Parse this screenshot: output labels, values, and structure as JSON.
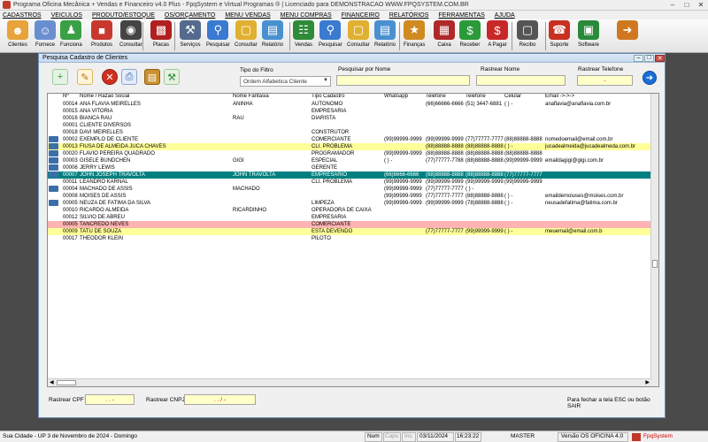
{
  "app": {
    "title": "Programa Oficina Mecânica + Vendas e Financeiro v4.0 Plus - FpqSystem e Virtual Programas ® | Licenciado para  DEMONSTRACAO WWW.FPQSYSTEM.COM.BR",
    "accent_color": "#008080"
  },
  "menu": [
    "CADASTROS",
    "VEICULOS",
    "PRODUTO/ESTOQUE",
    "OS/ORÇAMENTO",
    "MENU VENDAS",
    "MENU COMPRAS",
    "FINANCEIRO",
    "RELATÓRIOS",
    "FERRAMENTAS",
    "AJUDA"
  ],
  "toolbar": [
    {
      "label": "Clientes",
      "icon": "people-icon",
      "color": "#e8a33a"
    },
    {
      "label": "Fornece",
      "icon": "supplier-icon",
      "color": "#6a8fd0"
    },
    {
      "label": "Funciona",
      "icon": "employee-icon",
      "color": "#3aa045"
    },
    {
      "label": "Produtos",
      "icon": "products-icon",
      "color": "#c8382e"
    },
    {
      "label": "Consultar",
      "icon": "tire-icon",
      "color": "#444444"
    },
    {
      "label": "Placas",
      "icon": "car-icon",
      "color": "#b02020"
    },
    {
      "label": "Serviços",
      "icon": "tools-icon",
      "color": "#556b8d"
    },
    {
      "label": "Pesquisar",
      "icon": "search-doc-icon",
      "color": "#3a7ad0"
    },
    {
      "label": "Consultar",
      "icon": "folder-icon",
      "color": "#e0b030"
    },
    {
      "label": "Relatório",
      "icon": "report-icon",
      "color": "#4a90d0"
    },
    {
      "label": "Vendas",
      "icon": "cart-icon",
      "color": "#2e8b3a"
    },
    {
      "label": "Pesquisar",
      "icon": "search-doc-icon",
      "color": "#3a7ad0"
    },
    {
      "label": "Consultar",
      "icon": "folder-icon",
      "color": "#e0b030"
    },
    {
      "label": "Relatório",
      "icon": "report-icon",
      "color": "#4a90d0"
    },
    {
      "label": "Finanças",
      "icon": "finance-icon",
      "color": "#d08a20"
    },
    {
      "label": "Caixa",
      "icon": "cash-register-icon",
      "color": "#b02828"
    },
    {
      "label": "Receber",
      "icon": "money-receive-icon",
      "color": "#2a9a3a"
    },
    {
      "label": "A Pagar",
      "icon": "money-pay-icon",
      "color": "#c82828"
    },
    {
      "label": "Recibo",
      "icon": "receipt-icon",
      "color": "#555555"
    },
    {
      "label": "Suporte",
      "icon": "support-icon",
      "color": "#c83020"
    },
    {
      "label": "Software",
      "icon": "software-icon",
      "color": "#2a8a3a"
    },
    {
      "label": "",
      "icon": "exit-icon",
      "color": "#d07820"
    }
  ],
  "dialog": {
    "title": "Pesquisa Cadastro de Clientes",
    "filter_label": "Tipo do Filtro",
    "filter_value": "Ordem Alfabetica Cliente",
    "search_name_label": "Pesquisar por Nome",
    "search_name_value": "",
    "track_name_label": "Rastrear Nome",
    "track_name_value": "",
    "track_phone_label": "Rastrear Telefone",
    "track_phone_value": "-",
    "track_cpf_label": "Rastrear CPF",
    "track_cpf_value": ". . -",
    "track_cnpj_label": "Rastrear CNPJ",
    "track_cnpj_value": ". . / -",
    "hint": "Para fechar a tela ESC ou botão SAIR"
  },
  "grid": {
    "columns": [
      "Nº",
      "Nome / Razão Social",
      "Nome Fantasia",
      "Tipo Cadastro",
      "Whatsapp",
      "Telefone",
      "Telefone",
      "Celular",
      "Email ->->->"
    ],
    "rows": [
      {
        "mark": false,
        "style": "",
        "cells": [
          "00014",
          "ANA FLAVIA MEIRELLES",
          "ANINHA",
          "AUTONOMO",
          "",
          "(66)66666-6666",
          "(51) 3447-6881",
          "(  )    -",
          "anaflavia@anaflavia.com.br"
        ]
      },
      {
        "mark": false,
        "style": "",
        "cells": [
          "00015",
          "ANA VITORIA",
          "",
          "EMPRESARIA",
          "",
          "",
          "",
          "",
          ""
        ]
      },
      {
        "mark": false,
        "style": "",
        "cells": [
          "00016",
          "BIANCA RAU",
          "RAU",
          "DIARISTA",
          "",
          "",
          "",
          "",
          ""
        ]
      },
      {
        "mark": false,
        "style": "",
        "cells": [
          "00001",
          "CLIENTE DIVERSOS",
          "",
          "",
          "",
          "",
          "",
          "",
          ""
        ]
      },
      {
        "mark": false,
        "style": "",
        "cells": [
          "00018",
          "DAVI MEIRELLES",
          "",
          "CONSTRUTOR",
          "",
          "",
          "",
          "",
          ""
        ]
      },
      {
        "mark": true,
        "style": "",
        "cells": [
          "00002",
          "EXEMPLO DE CLIENTE",
          "",
          "COMERCIANTE",
          "(99)99999-9999",
          "(99)99999-9999",
          "(77)77777-7777",
          "(88)88888-8888",
          "nomedoemail@email.com.br"
        ]
      },
      {
        "mark": true,
        "style": "yellow",
        "cells": [
          "00013",
          "FIUSA DE ALMEIDA JUCA CHAVES",
          "",
          "CLI. PROBLEMA",
          "",
          "(88)88888-8888",
          "(88)88888-8888",
          "(  )    -",
          "jucadealmeida@jucadealmeda.com.br"
        ]
      },
      {
        "mark": true,
        "style": "",
        "cells": [
          "00020",
          "FLAVIO PEREIRA QUADRADO",
          "",
          "PROGRAMADOR",
          "(99)99999-9999",
          "(88)88888-8888",
          "(88)88888-8888",
          "(88)88888-8888",
          ""
        ]
      },
      {
        "mark": true,
        "style": "",
        "cells": [
          "00003",
          "GISELE BUNDCHEN",
          "GIGI",
          "ESPECIAL",
          "(  )    -",
          "(77)77777-7788",
          "(88)88888-8888",
          "(99)99999-9999",
          "emaildagigi@gigi.com.br"
        ]
      },
      {
        "mark": true,
        "style": "",
        "cells": [
          "00006",
          "JERRY LEWIS",
          "",
          "GERENTE",
          "",
          "",
          "",
          "",
          ""
        ]
      },
      {
        "mark": true,
        "style": "selected",
        "cells": [
          "00007",
          "JOHN JOSEPH TRAVOLTA",
          "JOHN TRAVOLTA",
          "EMPRESARIO",
          "(66)6666-6666",
          "(88)88888-8888",
          "(88)88888-8888",
          "(77)77777-7777",
          ""
        ]
      },
      {
        "mark": false,
        "style": "",
        "cells": [
          "00011",
          "LEANDRO KARNAL",
          "",
          "CLI. PROBLEMA",
          "(99)99999-9999",
          "(99)99999-9999",
          "(99)99999-9999",
          "(99)99999-9999",
          ""
        ]
      },
      {
        "mark": true,
        "style": "",
        "cells": [
          "00004",
          "MACHADO DE ASSIS",
          "MACHADO",
          "",
          "(99)99999-9999",
          "(77)77777-7777",
          "(  )    -",
          "",
          ""
        ]
      },
      {
        "mark": false,
        "style": "",
        "cells": [
          "00008",
          "MOISES DE ASSIS",
          "",
          "",
          "(99)99999-9999",
          "(77)77777-7777",
          "(88)88888-8888",
          "(  )    -",
          "emaildemoiuses@moises.com.br"
        ]
      },
      {
        "mark": true,
        "style": "",
        "cells": [
          "00005",
          "NEUZA DE FATIMA DA SILVA",
          "",
          "LIMPEZA",
          "(99)99999-9999",
          "(99)99999-9999",
          "(78)88888-8888",
          "(  )    -",
          "neusadefatima@fatima.com.br"
        ]
      },
      {
        "mark": false,
        "style": "",
        "cells": [
          "00010",
          "RICARDO ALMEIDA",
          "RICARDINHO",
          "OPERADORA DE CAIXA",
          "",
          "",
          "",
          "",
          ""
        ]
      },
      {
        "mark": false,
        "style": "",
        "cells": [
          "00012",
          "SILVIO DE ABREU",
          "",
          "EMPRESARIA",
          "",
          "",
          "",
          "",
          ""
        ]
      },
      {
        "mark": false,
        "style": "pink",
        "cells": [
          "00005",
          "TANCREDO NEVES",
          "",
          "COMERCIANTE",
          "",
          "",
          "",
          "",
          ""
        ]
      },
      {
        "mark": false,
        "style": "yellow",
        "cells": [
          "00009",
          "TATU DE SOUZA",
          "",
          "ESTA DEVENDO",
          "",
          "(77)77777-7777",
          "(99)99999-9999",
          "(  )    -",
          "meuemail@email.com.b"
        ]
      },
      {
        "mark": false,
        "style": "",
        "cells": [
          "00017",
          "THEODOR KLEIN",
          "",
          "PILOTO",
          "",
          "",
          "",
          "",
          ""
        ]
      }
    ]
  },
  "status": {
    "location": "Sua Cidade - UP   3 de Novembro de 2024 - Domingo",
    "num": "Num",
    "caps": "Caps",
    "ins": "Ins",
    "date": "03/11/2024",
    "time": "16:23:22",
    "user": "MASTER",
    "version": "Versão OS OFICINA 4.0",
    "brand": "FpqSystem"
  }
}
